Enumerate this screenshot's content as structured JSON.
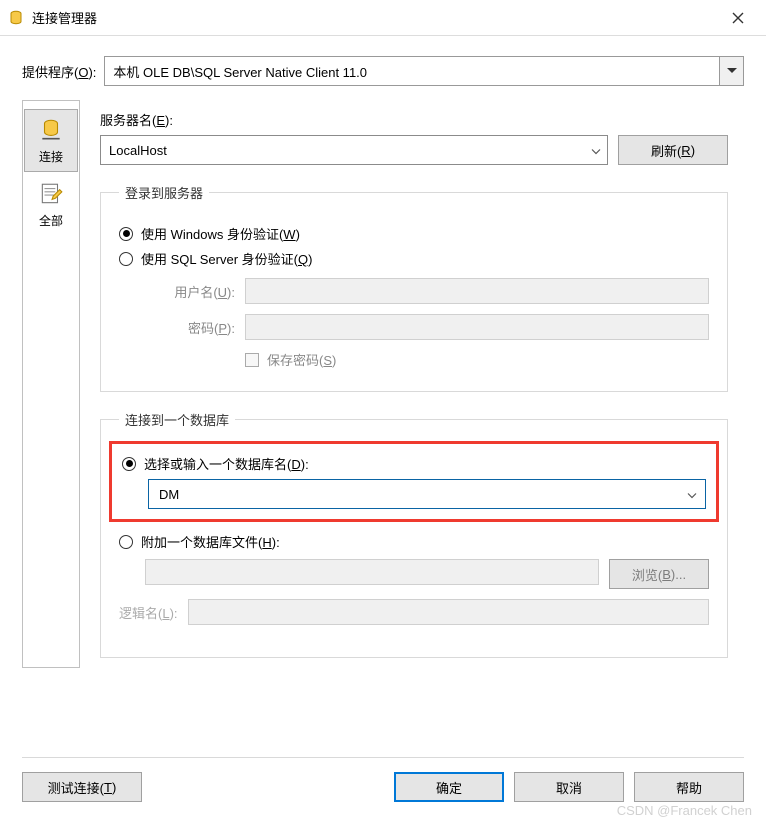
{
  "titlebar": {
    "title": "连接管理器"
  },
  "provider": {
    "label_pre": "提供程序(",
    "label_u": "O",
    "label_post": "):",
    "value": "本机 OLE DB\\SQL Server Native Client 11.0"
  },
  "sidebar": {
    "tab1": "连接",
    "tab2": "全部"
  },
  "server": {
    "label_pre": "服务器名(",
    "label_u": "E",
    "label_post": "):",
    "value": "LocalHost",
    "refresh_pre": "刷新(",
    "refresh_u": "R",
    "refresh_post": ")"
  },
  "login": {
    "legend": "登录到服务器",
    "opt_windows_pre": "使用 Windows 身份验证(",
    "opt_windows_u": "W",
    "opt_windows_post": ")",
    "opt_sql_pre": "使用 SQL Server 身份验证(",
    "opt_sql_u": "Q",
    "opt_sql_post": ")",
    "user_pre": "用户名(",
    "user_u": "U",
    "user_post": "):",
    "pass_pre": "密码(",
    "pass_u": "P",
    "pass_post": "):",
    "save_pre": "保存密码(",
    "save_u": "S",
    "save_post": ")"
  },
  "db": {
    "legend": "连接到一个数据库",
    "opt_select_pre": "选择或输入一个数据库名(",
    "opt_select_u": "D",
    "opt_select_post": "):",
    "selected": "DM",
    "opt_attach_pre": "附加一个数据库文件(",
    "opt_attach_u": "H",
    "opt_attach_post": "):",
    "browse_pre": "浏览(",
    "browse_u": "B",
    "browse_post": ")...",
    "logical_pre": "逻辑名(",
    "logical_u": "L",
    "logical_post": "):"
  },
  "footer": {
    "test_pre": "测试连接(",
    "test_u": "T",
    "test_post": ")",
    "ok": "确定",
    "cancel": "取消",
    "help": "帮助"
  },
  "watermark": "CSDN @Francek Chen"
}
